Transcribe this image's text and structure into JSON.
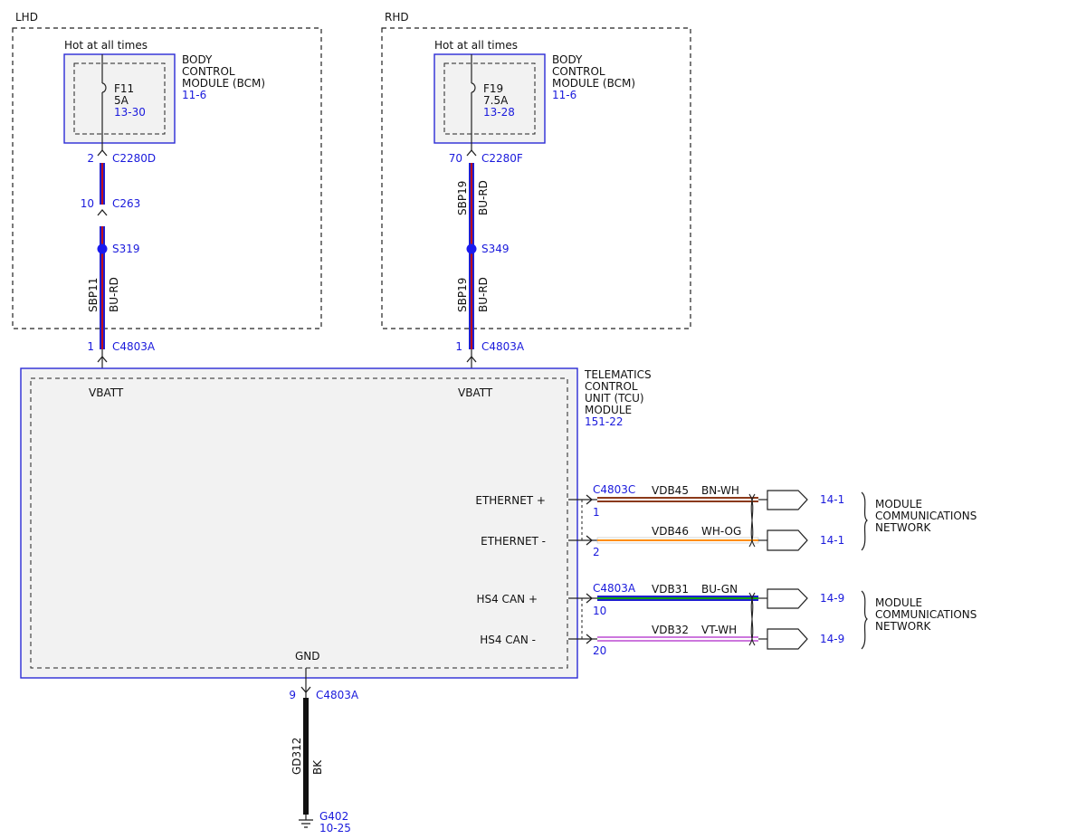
{
  "colors": {
    "module_blue": "#2b2bd6",
    "ref_blue": "#1a1adc",
    "module_fill": "#f2f2f2",
    "wire_bu_rd": [
      "#1f1fd0",
      "#c0101a"
    ],
    "wire_bn_wh": [
      "#8b3a1a",
      "#ffffff"
    ],
    "wire_wh_og": [
      "#ffffff",
      "#ff8c00"
    ],
    "wire_bu_gn": [
      "#1f1fd0",
      "#10a010"
    ],
    "wire_vt_wh": [
      "#cc77dd",
      "#ffffff"
    ],
    "wire_bk": "#111111"
  },
  "lhd": {
    "region_label": "LHD",
    "hot_label": "Hot at all times",
    "bcm_name": [
      "BODY",
      "CONTROL",
      "MODULE (BCM)"
    ],
    "bcm_ref": "11-6",
    "fuse_name": "F11",
    "fuse_rating": "5A",
    "fuse_ref": "13-30",
    "pin_bcm": "2",
    "conn_bcm": "C2280D",
    "pin_inline": "10",
    "conn_inline": "C263",
    "splice": "S319",
    "circuit": "SBP11",
    "wire_color": "BU-RD",
    "pin_tcu": "1",
    "conn_tcu": "C4803A"
  },
  "rhd": {
    "region_label": "RHD",
    "hot_label": "Hot at all times",
    "bcm_name": [
      "BODY",
      "CONTROL",
      "MODULE (BCM)"
    ],
    "bcm_ref": "11-6",
    "fuse_name": "F19",
    "fuse_rating": "7.5A",
    "fuse_ref": "13-28",
    "pin_bcm": "70",
    "conn_bcm": "C2280F",
    "splice": "S349",
    "circuit_upper": "SBP19",
    "wire_color_upper": "BU-RD",
    "circuit_lower": "SBP19",
    "wire_color_lower": "BU-RD",
    "pin_tcu": "1",
    "conn_tcu": "C4803A"
  },
  "tcu": {
    "name": [
      "TELEMATICS",
      "CONTROL",
      "UNIT (TCU)",
      "MODULE"
    ],
    "ref": "151-22",
    "vbatt_left": "VBATT",
    "vbatt_right": "VBATT",
    "gnd": "GND"
  },
  "network": {
    "groups": [
      {
        "connector": "C4803C",
        "label": [
          "MODULE",
          "COMMUNICATIONS",
          "NETWORK"
        ],
        "lines": [
          {
            "signal": "ETHERNET +",
            "pin": "1",
            "circuit": "VDB45",
            "color": "BN-WH",
            "ref": "14-1"
          },
          {
            "signal": "ETHERNET -",
            "pin": "2",
            "circuit": "VDB46",
            "color": "WH-OG",
            "ref": "14-1"
          }
        ]
      },
      {
        "connector": "C4803A",
        "label": [
          "MODULE",
          "COMMUNICATIONS",
          "NETWORK"
        ],
        "lines": [
          {
            "signal": "HS4 CAN +",
            "pin": "10",
            "circuit": "VDB31",
            "color": "BU-GN",
            "ref": "14-9"
          },
          {
            "signal": "HS4 CAN -",
            "pin": "20",
            "circuit": "VDB32",
            "color": "VT-WH",
            "ref": "14-9"
          }
        ]
      }
    ]
  },
  "ground": {
    "pin": "9",
    "connector": "C4803A",
    "circuit": "GD312",
    "color": "BK",
    "point": "G402",
    "ref": "10-25"
  }
}
